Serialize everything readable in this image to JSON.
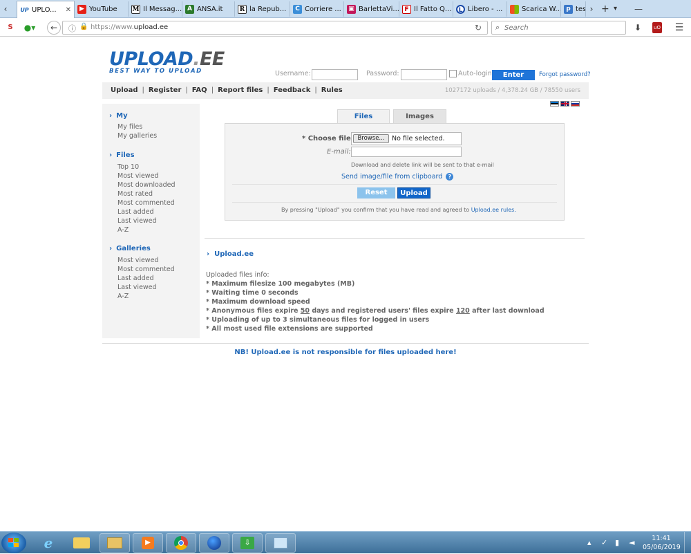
{
  "browser": {
    "tabs": [
      {
        "label": "UPLO...",
        "icon": "upload-ee-icon",
        "active": true
      },
      {
        "label": "YouTube",
        "icon": "youtube-icon"
      },
      {
        "label": "Il Messag...",
        "icon": "ilmessaggero-icon"
      },
      {
        "label": "ANSA.it",
        "icon": "ansa-icon"
      },
      {
        "label": "la Repub...",
        "icon": "repubblica-icon"
      },
      {
        "label": "Corriere ...",
        "icon": "corriere-icon"
      },
      {
        "label": "BarlettaVi...",
        "icon": "barlettaviva-icon"
      },
      {
        "label": "Il Fatto Q...",
        "icon": "ilfatto-icon"
      },
      {
        "label": "Libero - ...",
        "icon": "libero-icon"
      },
      {
        "label": "Scarica W...",
        "icon": "microsoft-icon"
      },
      {
        "label": "test",
        "icon": "p-icon"
      }
    ],
    "url_prefix": "https://www.",
    "url_domain": "upload.ee",
    "search_placeholder": "Search"
  },
  "header": {
    "logo_main": "UPLOAD",
    "logo_dot": ".",
    "logo_ext": "EE",
    "logo_tagline": "BEST WAY TO UPLOAD",
    "username_label": "Username:",
    "password_label": "Password:",
    "autologin_label": "Auto-login",
    "enter_label": "Enter",
    "forgot_label": "Forgot password?"
  },
  "menu": {
    "items": [
      "Upload",
      "Register",
      "FAQ",
      "Report files",
      "Feedback",
      "Rules"
    ],
    "stats": "1027172 uploads / 4,378.24 GB / 78550 users"
  },
  "flags": [
    {
      "name": "estonian-flag-icon",
      "colors": [
        "#0072ce",
        "#000000",
        "#ffffff"
      ]
    },
    {
      "name": "english-flag-icon",
      "colors": [
        "#012169",
        "#ffffff",
        "#c8102e"
      ]
    },
    {
      "name": "russian-flag-icon",
      "colors": [
        "#ffffff",
        "#0039a6",
        "#d52b1e"
      ]
    }
  ],
  "sidebar": {
    "sections": [
      {
        "title": "My",
        "links": [
          "My files",
          "My galleries"
        ]
      },
      {
        "title": "Files",
        "links": [
          "Top 10",
          "Most viewed",
          "Most downloaded",
          "Most rated",
          "Most commented",
          "Last added",
          "Last viewed",
          "A-Z"
        ]
      },
      {
        "title": "Galleries",
        "links": [
          "Most viewed",
          "Most commented",
          "Last added",
          "Last viewed",
          "A-Z"
        ]
      }
    ]
  },
  "upload_form": {
    "tab_files": "Files",
    "tab_images": "Images",
    "choose_file_label": "* Choose file:",
    "browse_label": "Browse...",
    "file_status": "No file selected.",
    "email_label": "E-mail:",
    "email_hint": "Download and delete link will be sent to that e-mail",
    "clipboard_link": "Send image/file from clipboard",
    "help_icon_glyph": "?",
    "reset_label": "Reset",
    "upload_label": "Upload",
    "agree_text": "By pressing \"Upload\" you confirm that you have read and agreed to",
    "agree_link": "Upload.ee rules."
  },
  "info": {
    "section_title": "Upload.ee",
    "title": "Uploaded files info:",
    "lines": [
      "* Maximum filesize 100 megabytes (MB)",
      "* Waiting time 0 seconds",
      "* Maximum download speed"
    ],
    "expire_prefix": "* Anonymous files expire ",
    "expire_anon_days": "50",
    "expire_mid": " days and registered users' files expire ",
    "expire_reg_days": "120",
    "expire_suffix": " after last download",
    "lines_after": [
      "* Uploading of up to 3 simultaneous files for logged in users",
      "* All most used file extensions are supported"
    ],
    "notice": "NB! Upload.ee is not responsible for files uploaded here!"
  },
  "taskbar": {
    "time": "11:41",
    "date": "05/06/2019"
  },
  "colors": {
    "brand_blue": "#1f67b7",
    "enter_button": "#1f74d8",
    "upload_button": "#1266c9",
    "reset_button": "#8cc3ec"
  }
}
